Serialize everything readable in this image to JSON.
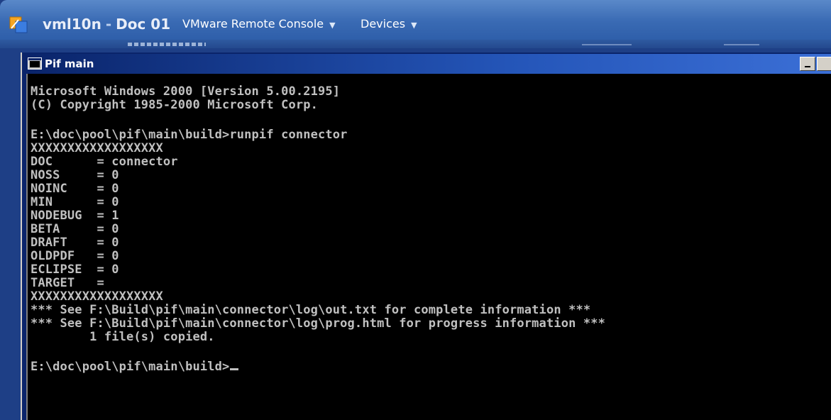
{
  "outer_window": {
    "title_host": "vml10n",
    "title_separator": "-",
    "title_doc": "Doc 01",
    "menus": [
      {
        "label": "VMware Remote Console"
      },
      {
        "label": "Devices"
      }
    ]
  },
  "console_window": {
    "title": "Pif main",
    "lines": [
      "Microsoft Windows 2000 [Version 5.00.2195]",
      "(C) Copyright 1985-2000 Microsoft Corp.",
      "",
      "E:\\doc\\pool\\pif\\main\\build>runpif connector",
      "XXXXXXXXXXXXXXXXXX",
      "DOC      = connector",
      "NOSS     = 0",
      "NOINC    = 0",
      "MIN      = 0",
      "NODEBUG  = 1",
      "BETA     = 0",
      "DRAFT    = 0",
      "OLDPDF   = 0",
      "ECLIPSE  = 0",
      "TARGET   =",
      "XXXXXXXXXXXXXXXXXX",
      "*** See F:\\Build\\pif\\main\\connector\\log\\out.txt for complete information ***",
      "*** See F:\\Build\\pif\\main\\connector\\log\\prog.html for progress information ***",
      "        1 file(s) copied.",
      "",
      "E:\\doc\\pool\\pif\\main\\build>"
    ]
  },
  "colors": {
    "outer_title_bar": "#3a6bb4",
    "console_bg": "#000000",
    "console_text": "#c0c0c0",
    "console_title_bar": "#0a246a"
  }
}
